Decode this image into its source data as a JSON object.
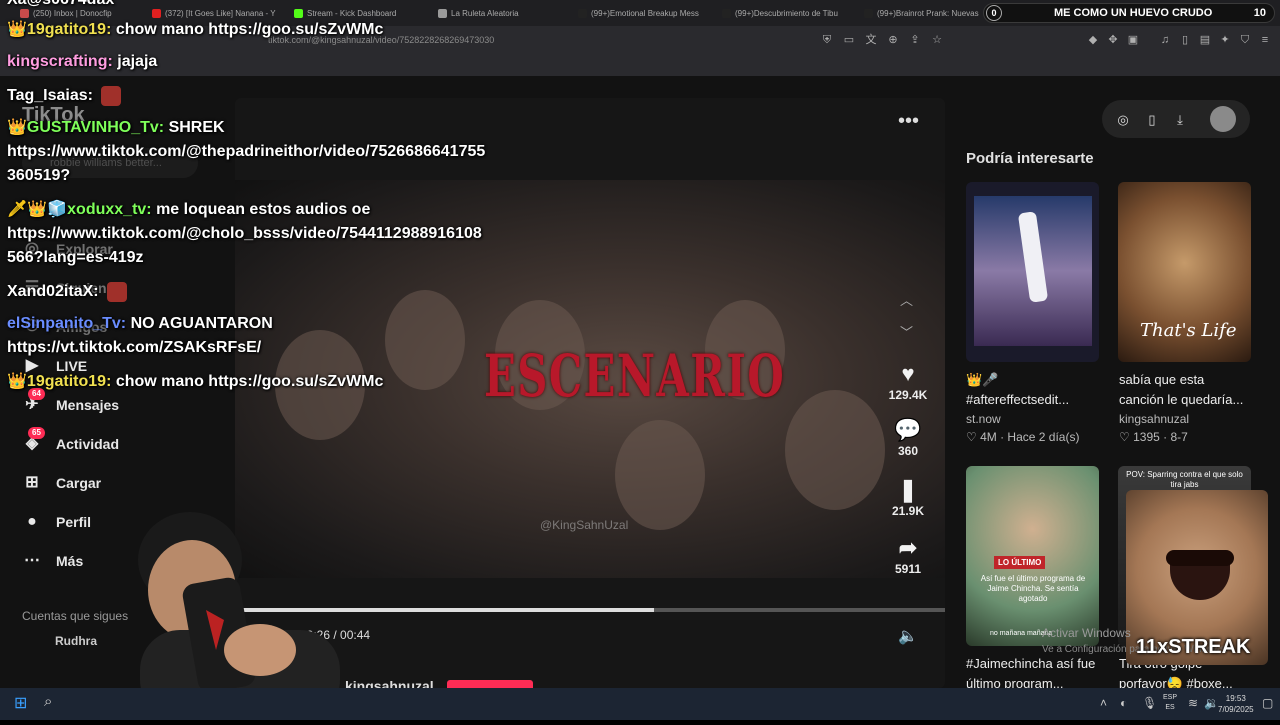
{
  "browser": {
    "tabs": [
      {
        "label": "(250) Inbox | Donocfip",
        "color": "#c94b4b"
      },
      {
        "label": "(372) [It Goes Like] Nanana - Y",
        "color": "#e02020"
      },
      {
        "label": "Stream - Kick Dashboard",
        "color": "#53fc18"
      },
      {
        "label": "La Ruleta Aleatoria",
        "color": "#9a9a9a"
      },
      {
        "label": "(99+)Emotional Breakup Mess",
        "color": "#222"
      },
      {
        "label": "(99+)Descubrimiento de Tibu",
        "color": "#222"
      },
      {
        "label": "(99+)Brainrot Prank: Nuevas",
        "color": "#222"
      }
    ],
    "url": "tiktok.com/@kingsahnuzal/video/7528228268269473030"
  },
  "stream_title": {
    "left_num": "0",
    "text": "ME COMO UN HUEVO CRUDO",
    "count": "10"
  },
  "chat": [
    {
      "user": "Xa@s0674dax",
      "text": ""
    },
    {
      "user": "19gatito19:",
      "text": "chow mano https://goo.su/sZvWMc",
      "color": "#f0e050",
      "crown": "👑"
    },
    {
      "user": "kingscrafting:",
      "text": "jajaja",
      "color": "#ff9de0"
    },
    {
      "user": "Tag_Isaias:",
      "text": "",
      "color": "#fff"
    },
    {
      "user": "GUSTAVINHO_Tv:",
      "text": "SHREK",
      "color": "#7fff5a",
      "crown": "👑"
    },
    {
      "user": "",
      "text": "https://www.tiktok.com/@thepadrineithor/video/7526686641755"
    },
    {
      "user": "",
      "text": "360519?"
    },
    {
      "user": "xoduxx_tv:",
      "text": "me loquean estos audios oe",
      "color": "#7fff5a",
      "crown": "🗡👑🧊"
    },
    {
      "user": "",
      "text": "https://www.tiktok.com/@cholo_bsss/video/7544112988916108"
    },
    {
      "user": "",
      "text": "566?lang=es-419z"
    },
    {
      "user": "Xand02itaX:",
      "text": "",
      "color": "#fff"
    },
    {
      "user": "elSinpanito_Tv:",
      "text": "NO AGUANTARON",
      "color": "#6a8dff"
    },
    {
      "user": "",
      "text": "https://vt.tiktok.com/ZSAKsRFsE/"
    },
    {
      "user": "19gatito19:",
      "text": "chow mano https://goo.su/sZvWMc",
      "color": "#f0e050",
      "crown": "👑"
    }
  ],
  "tiktok": {
    "logo": "TikTok",
    "search_placeholder": "robbie williams better...",
    "nav": [
      {
        "label": "Explorar",
        "icon": "compass-icon"
      },
      {
        "label": "Siguiendo",
        "icon": "following-icon"
      },
      {
        "label": "Amigos",
        "icon": "friends-icon"
      },
      {
        "label": "LIVE",
        "icon": "live-icon"
      },
      {
        "label": "Mensajes",
        "icon": "messages-icon",
        "badge": "64"
      },
      {
        "label": "Actividad",
        "icon": "activity-icon",
        "badge": "65"
      },
      {
        "label": "Cargar",
        "icon": "upload-icon"
      },
      {
        "label": "Perfil",
        "icon": "profile-icon"
      },
      {
        "label": "Más",
        "icon": "more-icon"
      }
    ],
    "following_header": "Cuentas que sigues",
    "following_first": "Rudhra",
    "video": {
      "overlay_text": "ESCENARIO",
      "watermark": "@KingSahnUzal",
      "likes": "129.4K",
      "comments": "360",
      "saves": "21.9K",
      "shares": "5911",
      "time": "00:26 / 00:44",
      "progress": 0.59,
      "author": "kingsahnuzal"
    },
    "recommendations_title": "Podría interesarte",
    "recommendations": [
      {
        "title": "👑🎤 #aftereffectsedit...",
        "author": "st.now",
        "stats": "♡ 4M · Hace 2 día(s)"
      },
      {
        "title": "sabía que esta canción le quedaría...",
        "author": "kingsahnuzal",
        "stats": "♡ 1395 · 8-7"
      },
      {
        "title": "#Jaimechincha así fue último program...",
        "author": "",
        "stats": ""
      },
      {
        "title": "Tira otro golpe porfavor😓 #boxe...",
        "author": "",
        "stats": ""
      }
    ],
    "thumb2_text": "That's Life",
    "thumb3_badge": "LO ÚLTIMO",
    "thumb3_caption": "Así fue el último programa de Jaime Chincha. Se sentía agotado",
    "thumb3_caption2": "no mañana mañana",
    "thumb4_caption": "POV: Sparring contra el que solo tira jabs"
  },
  "overlay": {
    "streak": "11xSTREAK",
    "activate_windows": "Activar Windows",
    "activate_sub": "Ve a Configuración para activar Windows."
  },
  "taskbar": {
    "lang1": "ESP",
    "lang2": "ES",
    "time": "19:53",
    "date": "7/09/2025"
  }
}
